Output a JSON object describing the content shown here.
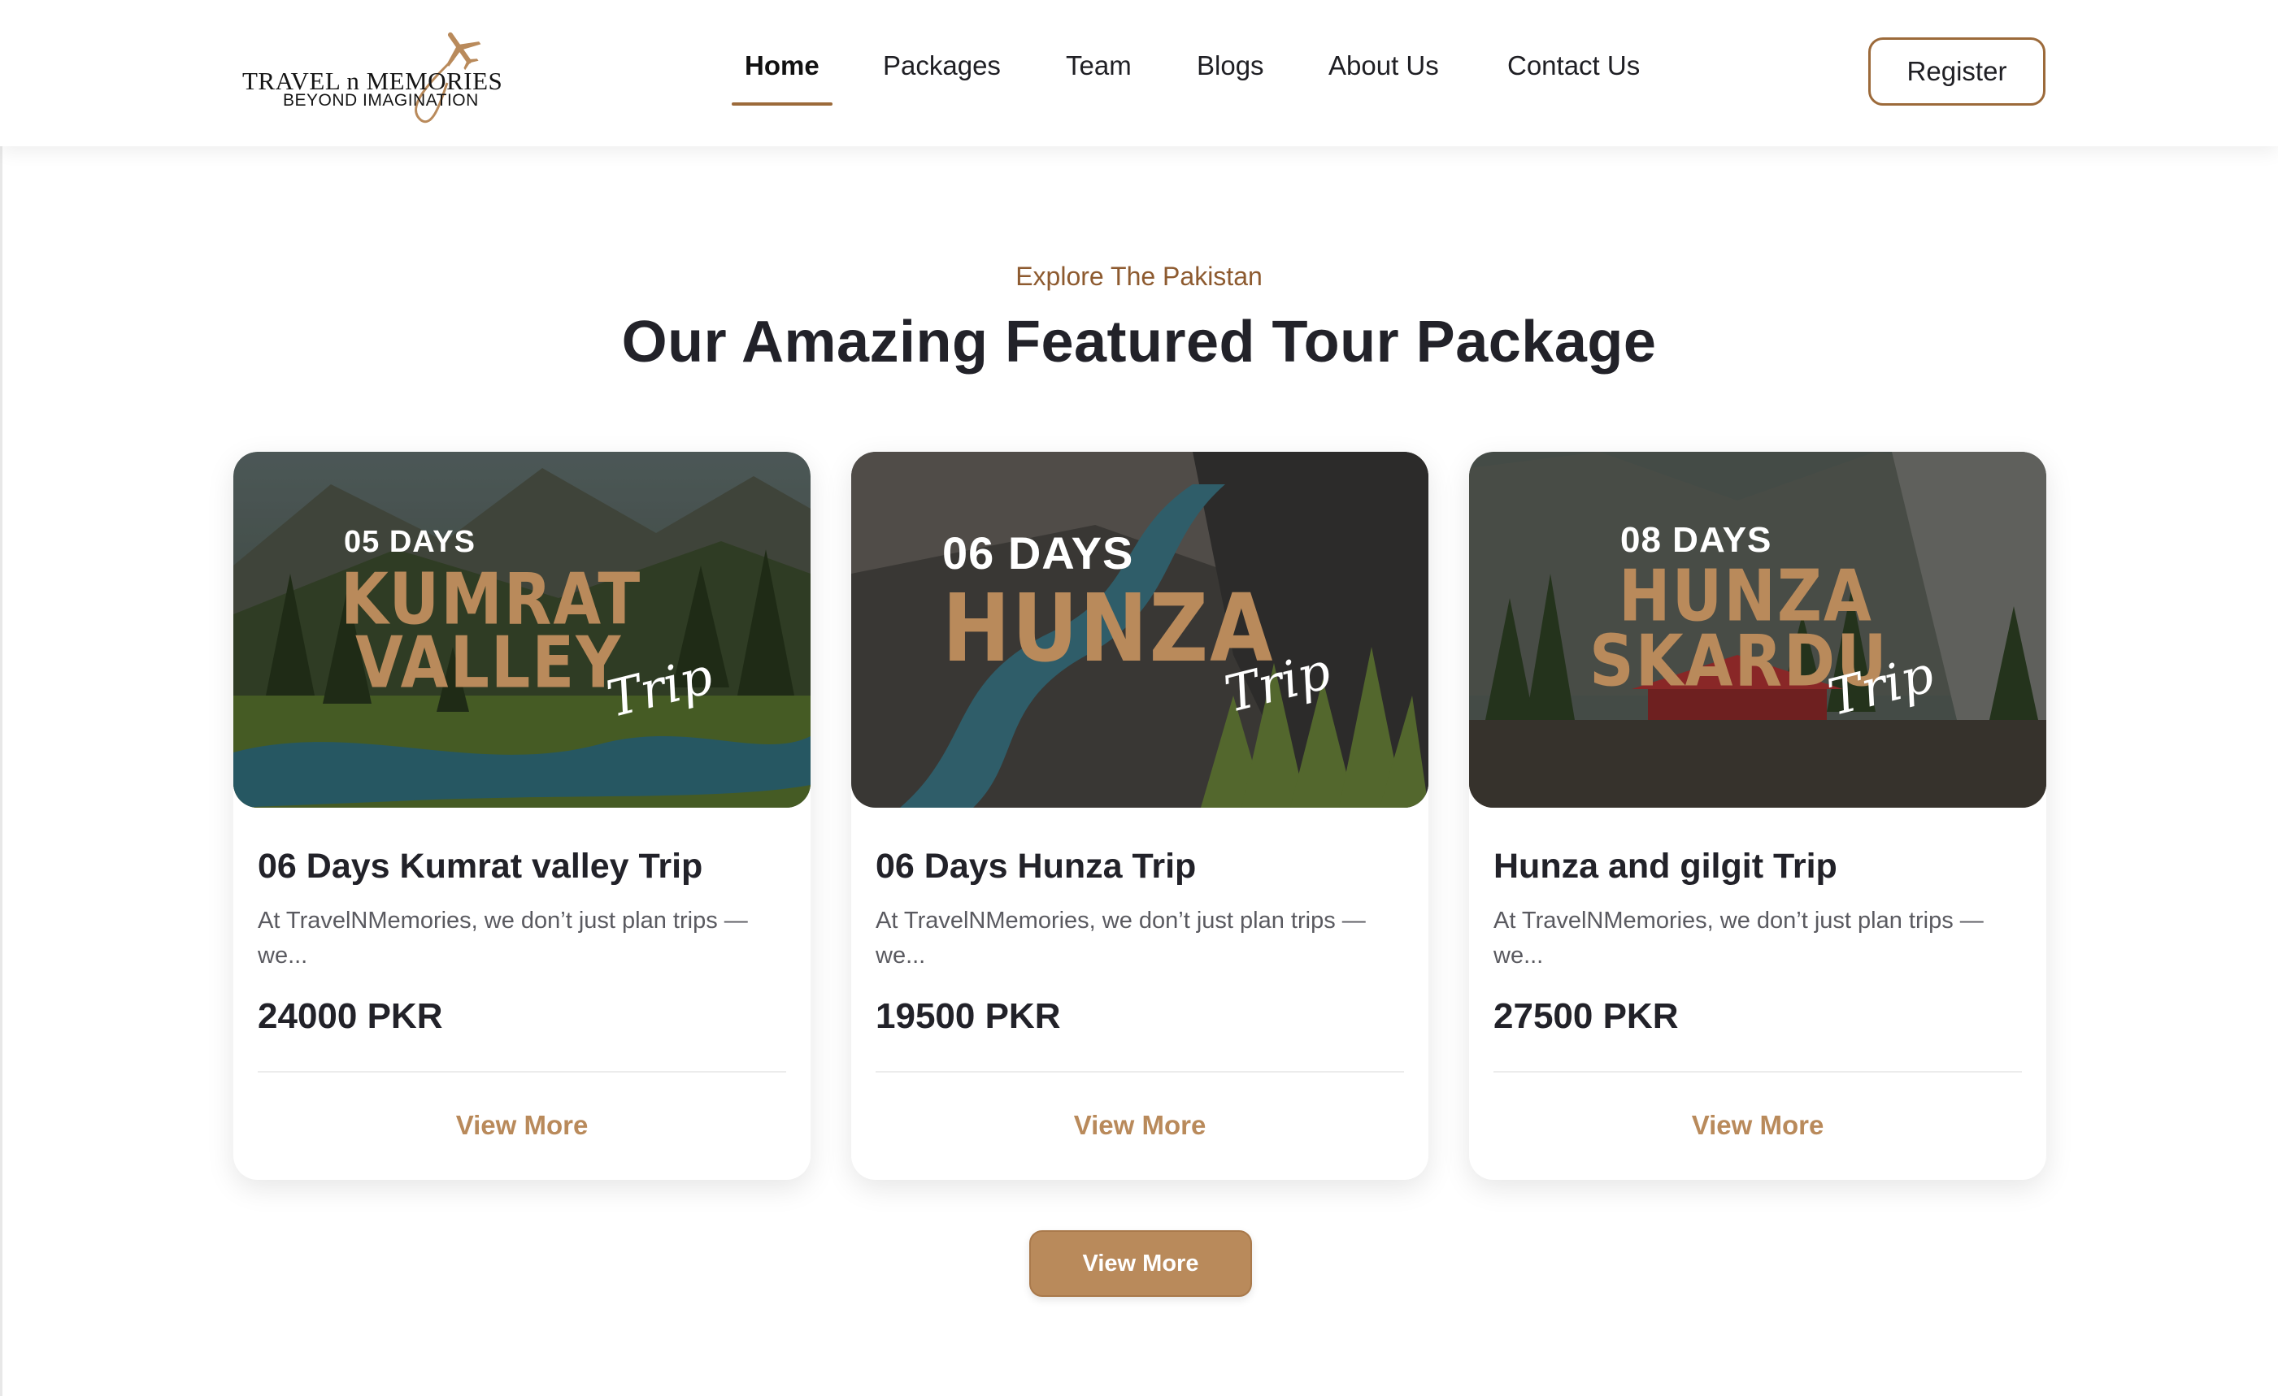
{
  "header": {
    "logo": {
      "line1": "TRAVEL n MEMORIES",
      "line2": "BEYOND IMAGINATION"
    },
    "nav": [
      {
        "label": "Home",
        "active": true
      },
      {
        "label": "Packages",
        "active": false
      },
      {
        "label": "Team",
        "active": false
      },
      {
        "label": "Blogs",
        "active": false
      },
      {
        "label": "About Us",
        "active": false
      },
      {
        "label": "Contact Us",
        "active": false
      }
    ],
    "register_label": "Register"
  },
  "section": {
    "eyebrow": "Explore The Pakistan",
    "title": "Our Amazing Featured Tour Package"
  },
  "packages": [
    {
      "image_days": "05 DAYS",
      "image_line1": "KUMRAT",
      "image_line2": "VALLEY",
      "image_trip": "Trip",
      "title": "06 Days Kumrat valley Trip",
      "description": "At TravelNMemories, we don’t just plan trips — we...",
      "price": "24000 PKR",
      "link": "View More"
    },
    {
      "image_days": "06 DAYS",
      "image_line1": "HUNZA",
      "image_line2": "",
      "image_trip": "Trip",
      "title": "06 Days Hunza Trip",
      "description": "At TravelNMemories, we don’t just plan trips — we...",
      "price": "19500 PKR",
      "link": "View More"
    },
    {
      "image_days": "08 DAYS",
      "image_line1": "HUNZA",
      "image_line2": "SKARDU",
      "image_trip": "Trip",
      "title": "Hunza and gilgit Trip",
      "description": "At TravelNMemories, we don’t just plan trips — we...",
      "price": "27500 PKR",
      "link": "View More"
    }
  ],
  "view_more_label": "View More",
  "colors": {
    "accent": "#b98a5b",
    "accent_dark": "#9c6a3a",
    "eyebrow": "#8d5a2f",
    "heading": "#222229"
  },
  "icons": {
    "logo_mark": "airplane-icon"
  }
}
